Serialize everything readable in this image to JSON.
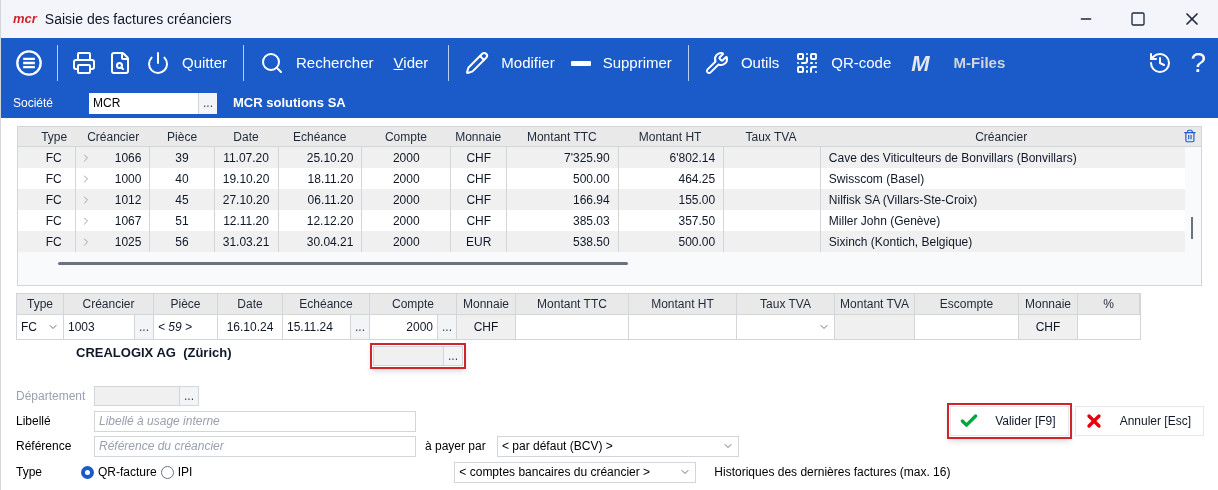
{
  "window": {
    "logo": "mcr",
    "title": "Saisie des factures créanciers"
  },
  "toolbar": [
    {
      "kind": "menu"
    },
    {
      "kind": "separator"
    },
    {
      "kind": "print"
    },
    {
      "kind": "preview"
    },
    {
      "kind": "power",
      "label": "Quitter"
    },
    {
      "kind": "separator"
    },
    {
      "kind": "search",
      "label": "Rechercher"
    },
    {
      "kind": "text",
      "label": "Vider",
      "accel": true
    },
    {
      "kind": "separator"
    },
    {
      "kind": "edit",
      "label": "Modifier"
    },
    {
      "kind": "delete",
      "label": "Supprimer"
    },
    {
      "kind": "separator"
    },
    {
      "kind": "tools",
      "label": "Outils"
    },
    {
      "kind": "qr",
      "label": "QR-code"
    },
    {
      "kind": "logo",
      "label": "M"
    },
    {
      "kind": "text",
      "label": "M-Files",
      "disabled": true
    }
  ],
  "toolbar_right": [
    {
      "kind": "history"
    },
    {
      "kind": "help",
      "label": "?"
    }
  ],
  "company": {
    "label": "Société",
    "code": "MCR",
    "button": "...",
    "name": "MCR solutions SA"
  },
  "grid": {
    "columns": [
      "Type",
      "Créancier",
      "Pièce",
      "Date",
      "Echéance",
      "Compte",
      "Monnaie",
      "Montant TTC",
      "Montant HT",
      "Taux TVA",
      "Créancier"
    ],
    "rows": [
      [
        "FC",
        "1066",
        "39",
        "11.07.20",
        "25.10.20",
        "2000",
        "CHF",
        "7'325.90",
        "6'802.14",
        "",
        "Cave des Viticulteurs de Bonvillars (Bonvillars)"
      ],
      [
        "FC",
        "1000",
        "40",
        "19.10.20",
        "18.11.20",
        "2000",
        "CHF",
        "500.00",
        "464.25",
        "",
        "Swisscom (Basel)"
      ],
      [
        "FC",
        "1012",
        "45",
        "27.10.20",
        "06.11.20",
        "2000",
        "CHF",
        "166.94",
        "155.00",
        "",
        "Nilfisk SA (Villars-Ste-Croix)"
      ],
      [
        "FC",
        "1067",
        "51",
        "12.11.20",
        "12.12.20",
        "2000",
        "CHF",
        "385.03",
        "357.50",
        "",
        "Miller John (Genève)"
      ],
      [
        "FC",
        "1025",
        "56",
        "31.03.21",
        "30.04.21",
        "2000",
        "EUR",
        "538.50",
        "500.00",
        "",
        "Sixinch (Kontich, Belgique)"
      ]
    ]
  },
  "entry": {
    "columns": [
      "Type",
      "Créancier",
      "Pièce",
      "Date",
      "Echéance",
      "Compte",
      "Monnaie",
      "Montant TTC",
      "Montant HT",
      "Taux TVA",
      "Montant TVA",
      "Escompte",
      "Monnaie",
      "%"
    ],
    "type": "FC",
    "creancier": "1003",
    "piece": "< 59 >",
    "date": "16.10.24",
    "echeance": "15.11.24",
    "compte": "2000",
    "monnaie": "CHF",
    "monnaie_2": "CHF",
    "more": "...",
    "creditor_name": "CREALOGIX AG  (Zürich)"
  },
  "form": {
    "departement": {
      "label": "Département",
      "disabled": true
    },
    "libelle": {
      "label": "Libellé",
      "placeholder": "Libellé à usage interne"
    },
    "reference": {
      "label": "Référence",
      "placeholder": "Référence du créancier"
    },
    "payer": {
      "label": "à payer par",
      "value": "< par défaut (BCV) >"
    },
    "type": {
      "label": "Type",
      "options": [
        {
          "label": "QR-facture",
          "selected": true
        },
        {
          "label": "IPI",
          "selected": false
        }
      ]
    },
    "bank": {
      "value": "< comptes bancaires du créancier >"
    },
    "history": "Historiques des dernières factures (max. 16)"
  },
  "buttons": [
    {
      "kind": "ok",
      "label": "Valider [F9]",
      "highlighted": true
    },
    {
      "kind": "cancel",
      "label": "Annuler [Esc]",
      "highlighted": false
    }
  ]
}
